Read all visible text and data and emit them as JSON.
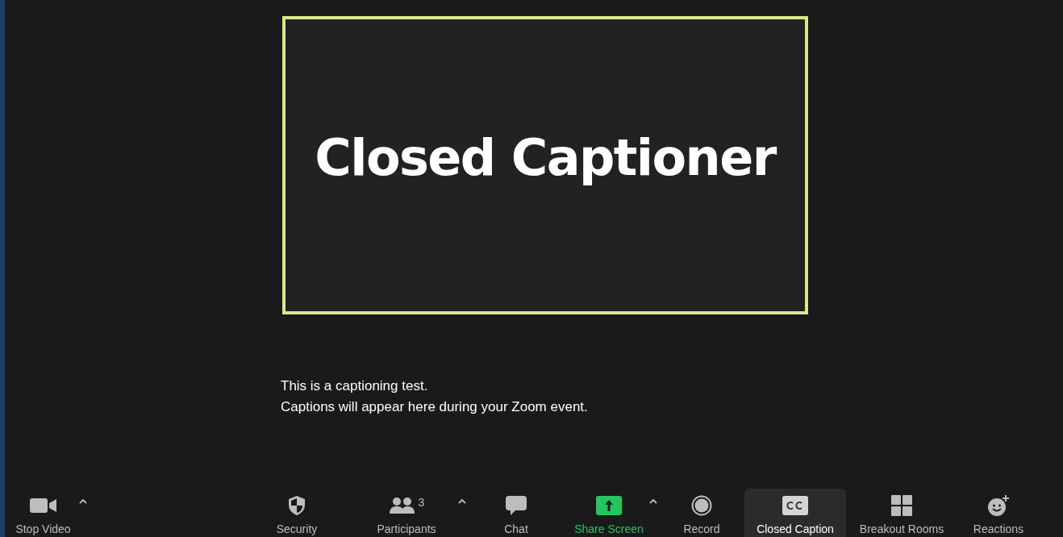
{
  "video_tile": {
    "title": "Closed Captioner"
  },
  "captions": [
    "This is a captioning test.",
    "Captions will appear here during your Zoom event."
  ],
  "toolbar": [
    {
      "kind": "video",
      "label": "Stop Video",
      "selected": false,
      "active": false
    },
    {
      "kind": "caret"
    },
    {
      "kind": "security",
      "label": "Security",
      "selected": false,
      "active": false
    },
    {
      "kind": "participants",
      "label": "Participants",
      "count": "3",
      "selected": false,
      "active": false
    },
    {
      "kind": "caret"
    },
    {
      "kind": "chat",
      "label": "Chat",
      "selected": false,
      "active": false
    },
    {
      "kind": "share",
      "label": "Share Screen",
      "selected": false,
      "active": true
    },
    {
      "kind": "caret"
    },
    {
      "kind": "record",
      "label": "Record",
      "selected": false,
      "active": false
    },
    {
      "kind": "cc",
      "label": "Closed Caption",
      "selected": true,
      "active": false
    },
    {
      "kind": "breakout",
      "label": "Breakout Rooms",
      "selected": false,
      "active": false
    },
    {
      "kind": "reactions",
      "label": "Reactions",
      "selected": false,
      "active": false
    }
  ]
}
